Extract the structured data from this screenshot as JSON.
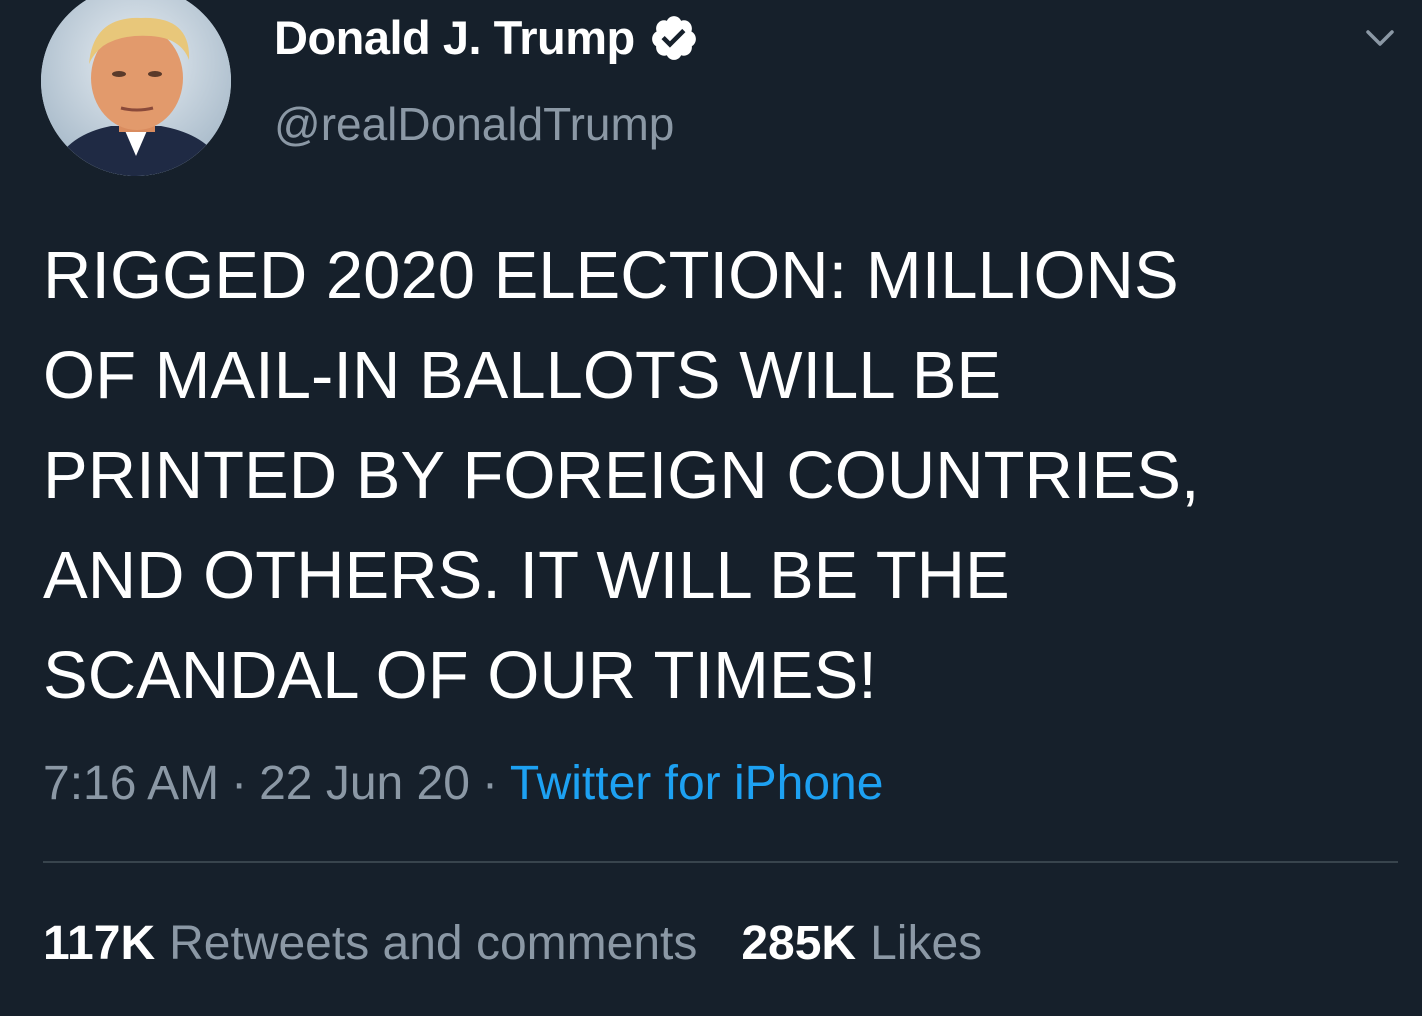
{
  "user": {
    "display_name": "Donald J. Trump",
    "handle": "@realDonaldTrump",
    "verified": true,
    "avatar_icon": "profile-photo",
    "verified_icon": "verified-badge-icon"
  },
  "tweet": {
    "lines": [
      "RIGGED 2020 ELECTION: MILLIONS",
      "OF MAIL-IN BALLOTS WILL BE",
      "PRINTED BY FOREIGN COUNTRIES,",
      "AND OTHERS. IT WILL BE THE",
      "SCANDAL OF OUR TIMES!"
    ],
    "time": "7:16 AM",
    "date": "22 Jun 20",
    "separator": "·",
    "source": "Twitter for iPhone"
  },
  "stats": {
    "retweets_count": "117K",
    "retweets_label": "Retweets and comments",
    "likes_count": "285K",
    "likes_label": "Likes"
  },
  "menu": {
    "icon": "chevron-down-icon"
  },
  "colors": {
    "background": "#16202b",
    "text_primary": "#ffffff",
    "text_secondary": "#8b98a5",
    "link": "#1da1f2",
    "divider": "#38444d"
  }
}
